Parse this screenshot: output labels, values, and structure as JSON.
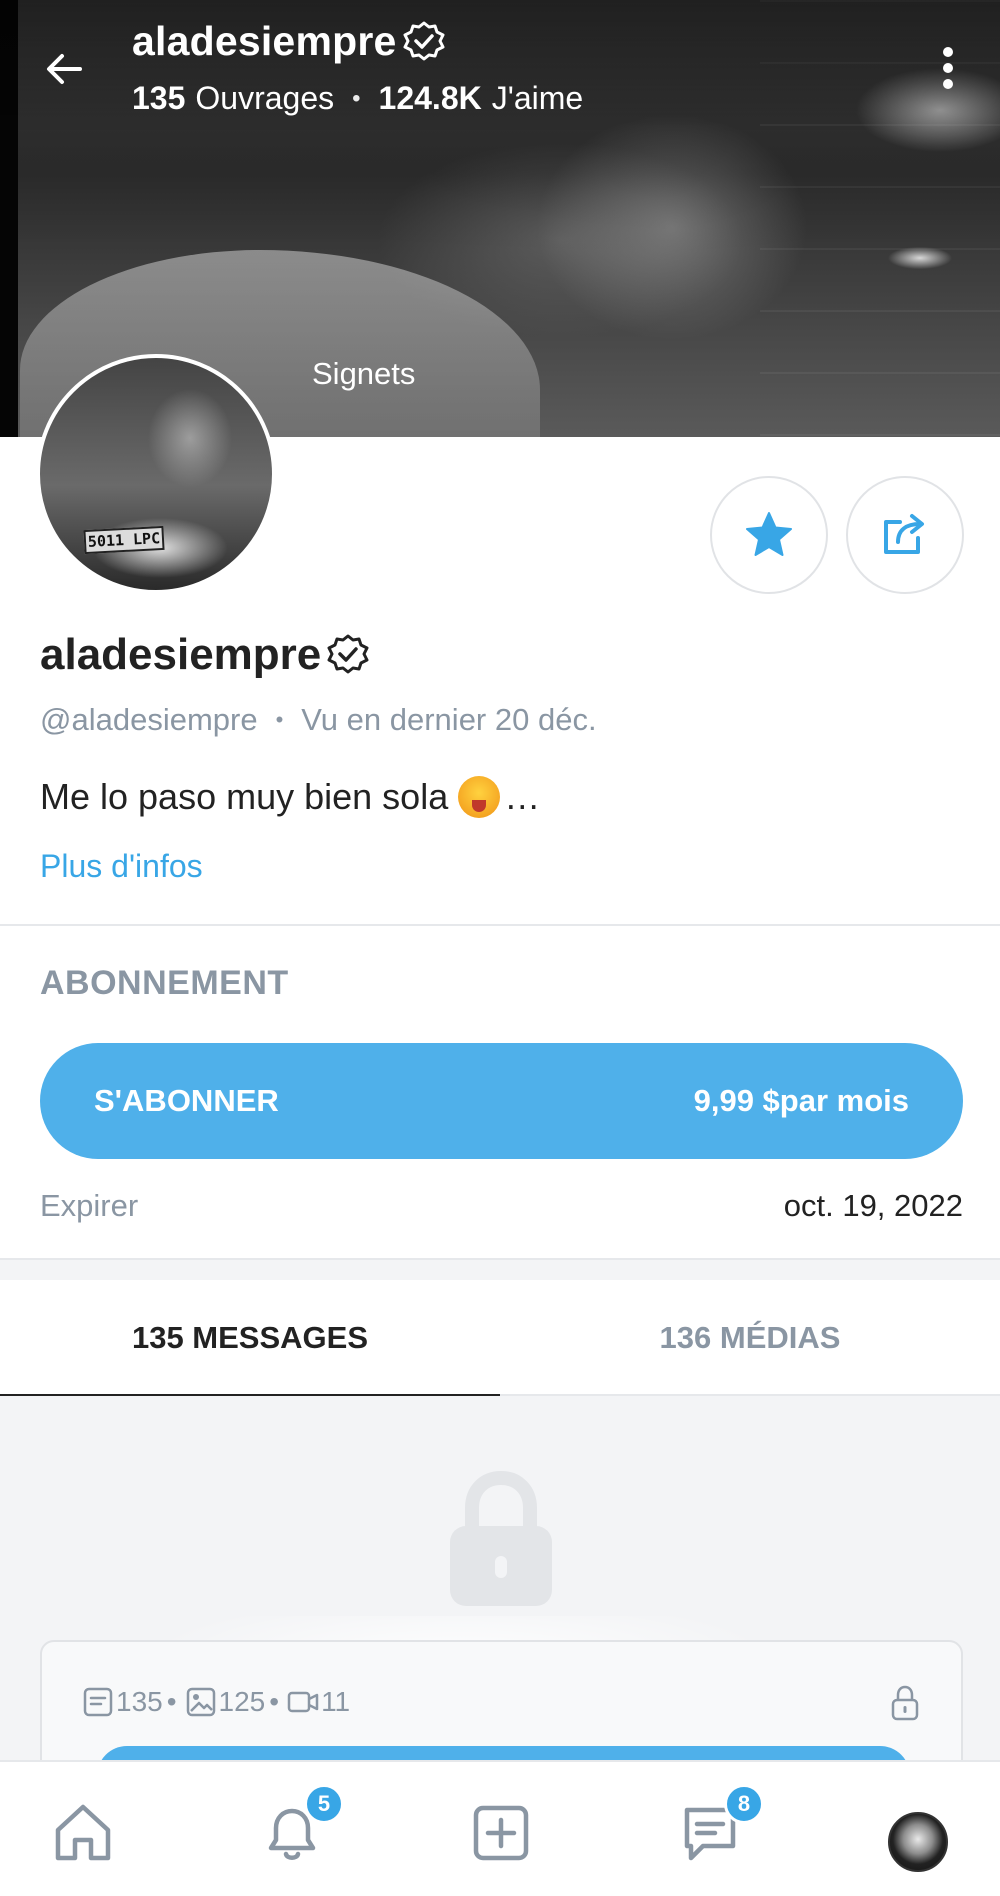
{
  "header": {
    "username": "aladesiempre",
    "works_count": "135",
    "works_label": "Ouvrages",
    "likes_count": "124.8K",
    "likes_label": "J'aime",
    "separator": "•",
    "cover_label": "Signets"
  },
  "avatar": {
    "plate_text": "5011 LPC"
  },
  "profile": {
    "display_name": "aladesiempre",
    "handle": "@aladesiempre",
    "separator": "•",
    "last_seen": "Vu en dernier 20 déc.",
    "bio": "Me lo paso muy bien sola",
    "bio_ellipsis": "…",
    "more_info": "Plus d'infos"
  },
  "subscription": {
    "heading": "ABONNEMENT",
    "button_label": "S'ABONNER",
    "price": "9,99 $par mois",
    "expire_label": "Expirer",
    "expire_date": "oct. 19, 2022"
  },
  "tabs": [
    {
      "label": "135 MESSAGES",
      "active": true
    },
    {
      "label": "136 MÉDIAS",
      "active": false
    }
  ],
  "locked_card": {
    "posts": "135",
    "images": "125",
    "videos": "11",
    "sep": "•"
  },
  "bottom_nav": {
    "notifications_badge": "5",
    "messages_badge": "8"
  },
  "colors": {
    "accent": "#4fb0ea",
    "link": "#38a6e6",
    "muted": "#8a96a3",
    "text": "#222222",
    "divider": "#e6e8eb"
  },
  "icons": [
    "back-arrow-icon",
    "verified-icon",
    "more-vertical-icon",
    "star-icon",
    "share-icon",
    "lock-icon",
    "post-icon",
    "image-icon",
    "video-icon",
    "home-icon",
    "bell-icon",
    "add-icon",
    "chat-icon"
  ]
}
